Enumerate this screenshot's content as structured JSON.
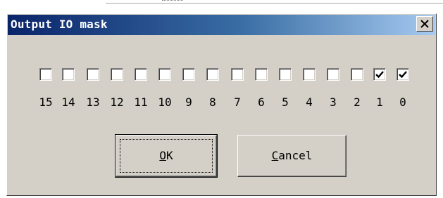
{
  "window": {
    "title": "Output IO mask",
    "close_label": "×"
  },
  "bits": [
    {
      "label": "15",
      "checked": false
    },
    {
      "label": "14",
      "checked": false
    },
    {
      "label": "13",
      "checked": false
    },
    {
      "label": "12",
      "checked": false
    },
    {
      "label": "11",
      "checked": false
    },
    {
      "label": "10",
      "checked": false
    },
    {
      "label": "9",
      "checked": false
    },
    {
      "label": "8",
      "checked": false
    },
    {
      "label": "7",
      "checked": false
    },
    {
      "label": "6",
      "checked": false
    },
    {
      "label": "5",
      "checked": false
    },
    {
      "label": "4",
      "checked": false
    },
    {
      "label": "3",
      "checked": false
    },
    {
      "label": "2",
      "checked": false
    },
    {
      "label": "1",
      "checked": true
    },
    {
      "label": "0",
      "checked": true
    }
  ],
  "buttons": {
    "ok": {
      "mnemonic": "O",
      "rest": "K"
    },
    "cancel": {
      "mnemonic": "C",
      "rest": "ancel"
    }
  },
  "colors": {
    "title_start": "#0a246a",
    "title_end": "#a6caf0",
    "face": "#d4d0c8"
  },
  "icons": {
    "close": "close-icon",
    "check": "checkmark-icon"
  }
}
